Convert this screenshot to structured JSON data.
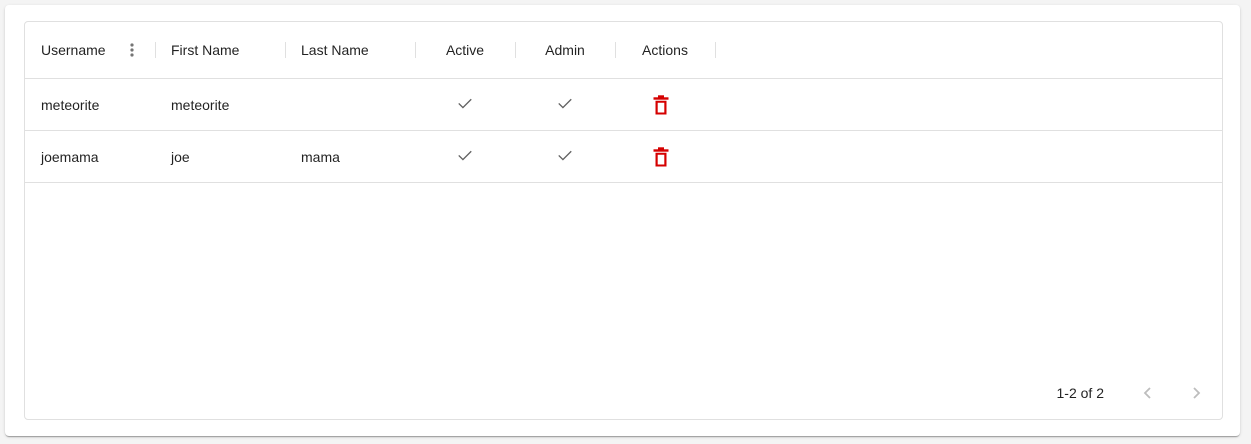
{
  "table": {
    "columns": [
      {
        "label": "Username"
      },
      {
        "label": "First Name"
      },
      {
        "label": "Last Name"
      },
      {
        "label": "Active"
      },
      {
        "label": "Admin"
      },
      {
        "label": "Actions"
      }
    ],
    "rows": [
      {
        "username": "meteorite",
        "first_name": "meteorite",
        "last_name": "",
        "active": true,
        "admin": true
      },
      {
        "username": "joemama",
        "first_name": "joe",
        "last_name": "mama",
        "active": true,
        "admin": true
      }
    ],
    "icons": {
      "column_menu": "more-vert-icon",
      "check": "check-icon",
      "delete": "trash-icon",
      "prev": "chevron-left-icon",
      "next": "chevron-right-icon"
    },
    "colors": {
      "delete": "#d50000",
      "check": "#616161",
      "border": "#e0e0e0"
    }
  },
  "pagination": {
    "range_text": "1-2 of 2"
  }
}
